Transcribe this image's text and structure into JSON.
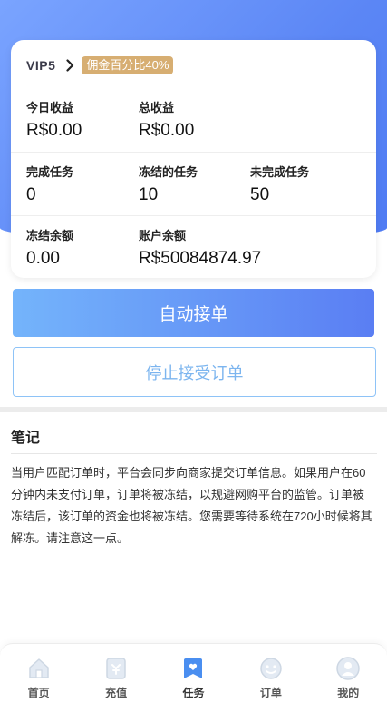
{
  "card": {
    "vip_level": "VIP5",
    "commission_badge": "佣金百分比40%",
    "today_income_label": "今日收益",
    "today_income_value": "R$0.00",
    "total_income_label": "总收益",
    "total_income_value": "R$0.00",
    "completed_tasks_label": "完成任务",
    "completed_tasks_value": "0",
    "frozen_tasks_label": "冻结的任务",
    "frozen_tasks_value": "10",
    "uncompleted_tasks_label": "未完成任务",
    "uncompleted_tasks_value": "50",
    "frozen_balance_label": "冻结余额",
    "frozen_balance_value": "0.00",
    "account_balance_label": "账户余额",
    "account_balance_value": "R$50084874.97"
  },
  "actions": {
    "auto_accept_label": "自动接单",
    "stop_accept_label": "停止接受订单"
  },
  "notes": {
    "title": "笔记",
    "body": "当用户匹配订单时，平台会同步向商家提交订单信息。如果用户在60分钟内未支付订单，订单将被冻结，以规避网购平台的监管。订单被冻结后，该订单的资金也将被冻结。您需要等待系统在720小时候将其解冻。请注意这一点。"
  },
  "tabbar": {
    "items": [
      {
        "label": "首页",
        "icon": "home-icon"
      },
      {
        "label": "充值",
        "icon": "recharge-icon"
      },
      {
        "label": "任务",
        "icon": "task-icon"
      },
      {
        "label": "订单",
        "icon": "order-icon"
      },
      {
        "label": "我的",
        "icon": "profile-icon"
      }
    ],
    "active_index": 2
  },
  "colors": {
    "primary_gradient_start": "#74b4fb",
    "primary_gradient_end": "#5a7ef3",
    "badge": "#d7ae72",
    "active_tab": "#4a8ef0"
  }
}
